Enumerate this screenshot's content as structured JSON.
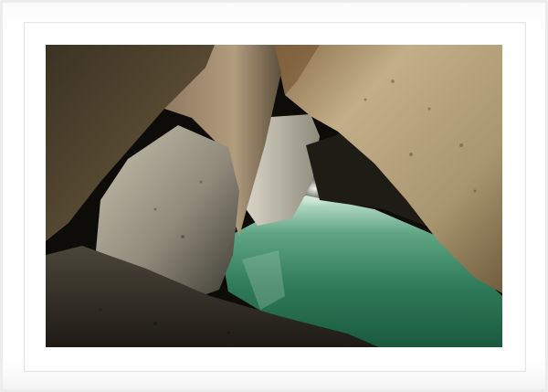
{
  "artwork": {
    "subject": "sea-cave-with-boulders",
    "water_color": "#3f8a66",
    "rock_color": "#a89878",
    "shadow_color": "#0d0d08"
  },
  "frame": {
    "color": "#ffffff",
    "mat_color": "#ffffff"
  }
}
